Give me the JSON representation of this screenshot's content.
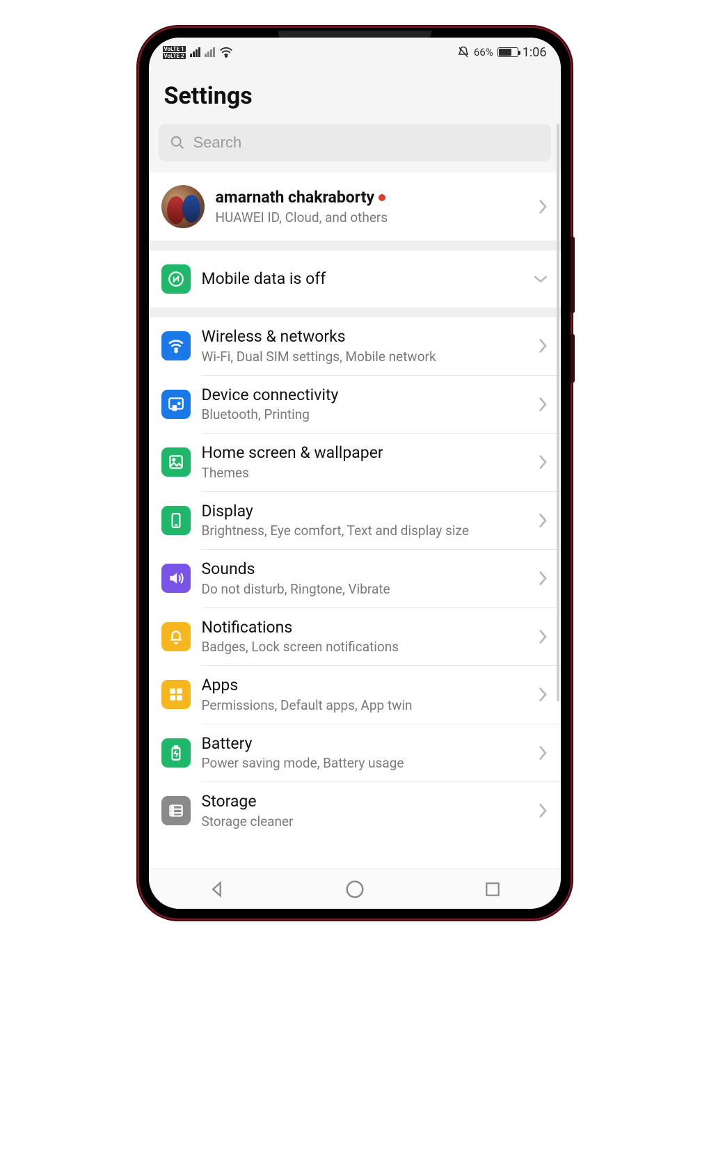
{
  "statusbar": {
    "volte1": "VoLTE 1",
    "volte2": "VoLTE 2",
    "mute_icon": "bell-off",
    "battery_pct": "66%",
    "time": "1:06"
  },
  "page_title": "Settings",
  "search": {
    "placeholder": "Search"
  },
  "account": {
    "name": "amarnath chakraborty",
    "subtitle": "HUAWEI ID, Cloud, and others"
  },
  "mobile_data": {
    "title": "Mobile data is off"
  },
  "items": [
    {
      "icon": "wifi",
      "color": "bg-blue",
      "title": "Wireless & networks",
      "subtitle": "Wi-Fi, Dual SIM settings, Mobile network"
    },
    {
      "icon": "cast",
      "color": "bg-blue",
      "title": "Device connectivity",
      "subtitle": "Bluetooth, Printing"
    },
    {
      "icon": "image",
      "color": "bg-green",
      "title": "Home screen & wallpaper",
      "subtitle": "Themes"
    },
    {
      "icon": "tablet",
      "color": "bg-green",
      "title": "Display",
      "subtitle": "Brightness, Eye comfort, Text and display size"
    },
    {
      "icon": "volume",
      "color": "bg-purple",
      "title": "Sounds",
      "subtitle": "Do not disturb, Ringtone, Vibrate"
    },
    {
      "icon": "bell",
      "color": "bg-yellow",
      "title": "Notifications",
      "subtitle": "Badges, Lock screen notifications"
    },
    {
      "icon": "grid",
      "color": "bg-yellow",
      "title": "Apps",
      "subtitle": "Permissions, Default apps, App twin"
    },
    {
      "icon": "battery",
      "color": "bg-green",
      "title": "Battery",
      "subtitle": "Power saving mode, Battery usage"
    },
    {
      "icon": "storage",
      "color": "bg-grey",
      "title": "Storage",
      "subtitle": "Storage cleaner"
    }
  ]
}
